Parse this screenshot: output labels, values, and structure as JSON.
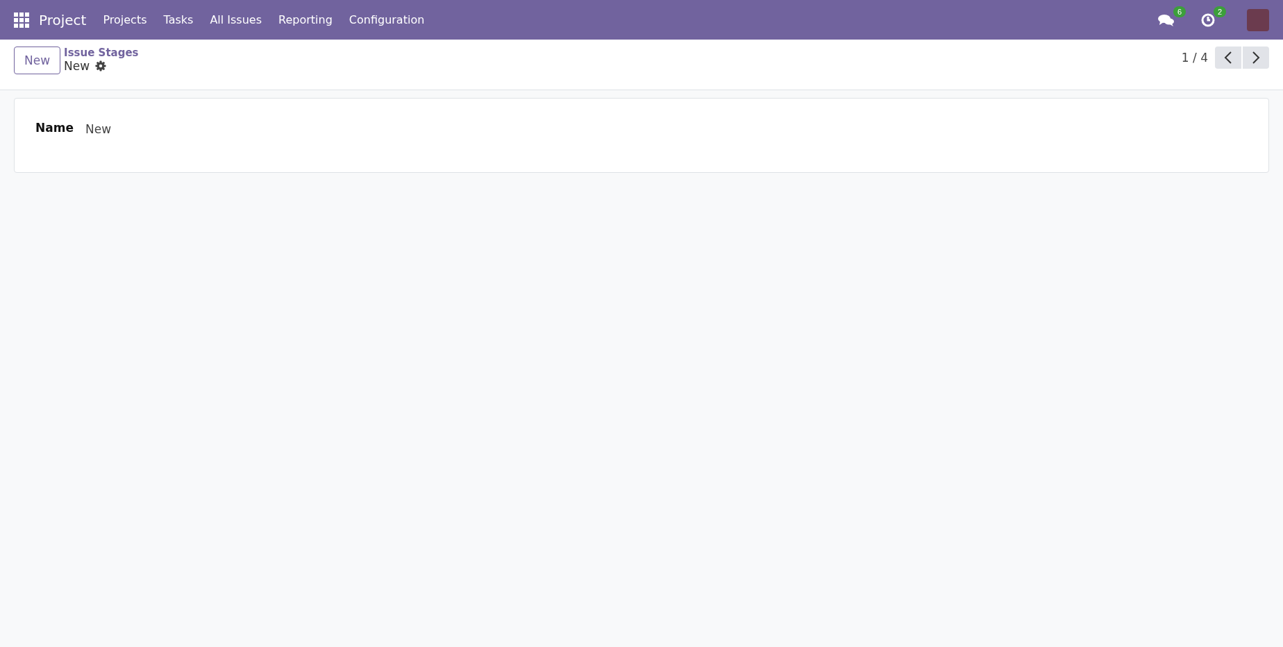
{
  "navbar": {
    "app_name": "Project",
    "menu": [
      "Projects",
      "Tasks",
      "All Issues",
      "Reporting",
      "Configuration"
    ],
    "messages_count": "6",
    "activities_count": "2"
  },
  "control_panel": {
    "new_button": "New",
    "breadcrumb": "Issue Stages",
    "record_title": "New",
    "pager": "1 / 4"
  },
  "form": {
    "fields": [
      {
        "label": "Name",
        "value": "New"
      }
    ]
  }
}
